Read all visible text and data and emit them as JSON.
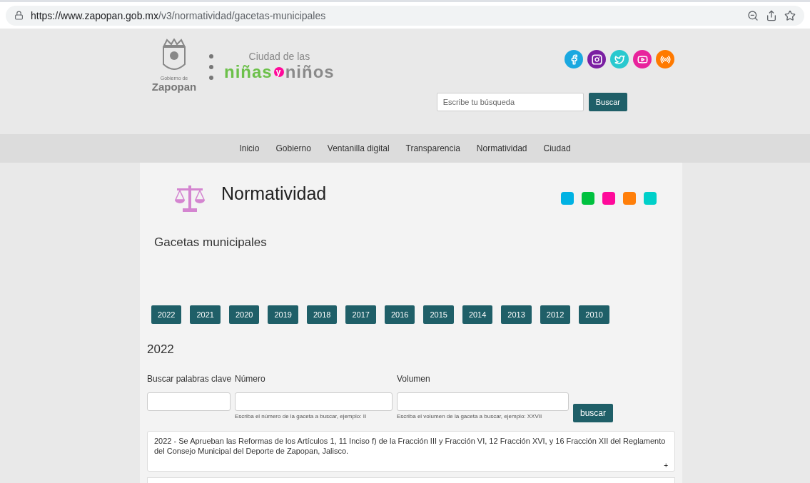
{
  "browser": {
    "url_host": "https://www.zapopan.gob.mx",
    "url_path": "/v3/normatividad/gacetas-municipales"
  },
  "header": {
    "logo": {
      "small": "Gobierno de",
      "name": "Zapopan"
    },
    "campaign": {
      "top": "Ciudad de las",
      "left": "niñas",
      "mid": "y",
      "right": "niños"
    },
    "search": {
      "placeholder": "Escribe tu búsqueda",
      "button": "Buscar"
    }
  },
  "nav": [
    "Inicio",
    "Gobierno",
    "Ventanilla digital",
    "Transparencia",
    "Normatividad",
    "Ciudad"
  ],
  "section": {
    "title": "Normatividad",
    "swatches": [
      {
        "color": "#00b2e3"
      },
      {
        "color": "#00c13f"
      },
      {
        "color": "#ff0a9a"
      },
      {
        "color": "#ff7f0a"
      },
      {
        "color": "#00d0c9"
      }
    ]
  },
  "subtitle": "Gacetas municipales",
  "years": [
    "2022",
    "2021",
    "2020",
    "2019",
    "2018",
    "2017",
    "2016",
    "2015",
    "2014",
    "2013",
    "2012",
    "2010"
  ],
  "year_heading": "2022",
  "filters": {
    "keywords": {
      "label": "Buscar palabras clave"
    },
    "number": {
      "label": "Número",
      "hint": "Escriba el número de la gaceta a buscar, ejemplo: II"
    },
    "volume": {
      "label": "Volumen",
      "hint": "Escriba el volumen de la gaceta a buscar, ejemplo: XXVII"
    },
    "button": "buscar"
  },
  "results": [
    {
      "text": "2022 - Se Aprueban las Reformas de los Artículos 1, 11 Inciso f) de la Fracción III y Fracción VI, 12 Fracción XVI, y 16 Fracción XII del Reglamento del Consejo Municipal del Deporte de Zapopan, Jalisco.",
      "toggle": "+"
    }
  ]
}
